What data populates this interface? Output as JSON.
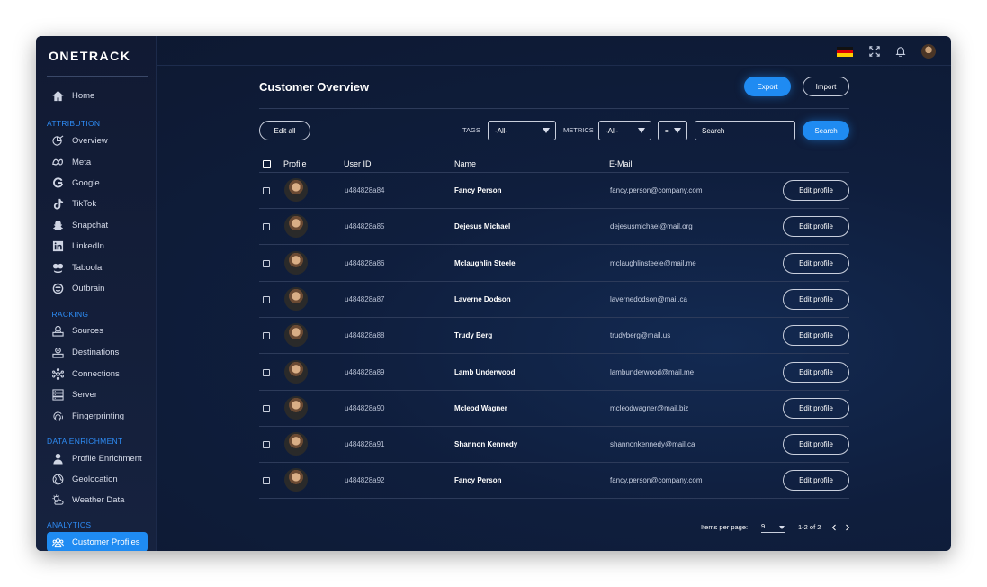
{
  "app": {
    "logo": "ONETRACK"
  },
  "sidebar": {
    "items": [
      {
        "label": "Home",
        "icon": "home-icon"
      },
      {
        "section": "ATTRIBUTION"
      },
      {
        "label": "Overview",
        "icon": "overview-icon"
      },
      {
        "label": "Meta",
        "icon": "meta-icon"
      },
      {
        "label": "Google",
        "icon": "google-icon"
      },
      {
        "label": "TikTok",
        "icon": "tiktok-icon"
      },
      {
        "label": "Snapchat",
        "icon": "snapchat-icon"
      },
      {
        "label": "LinkedIn",
        "icon": "linkedin-icon"
      },
      {
        "label": "Taboola",
        "icon": "taboola-icon"
      },
      {
        "label": "Outbrain",
        "icon": "outbrain-icon"
      },
      {
        "section": "TRACKING"
      },
      {
        "label": "Sources",
        "icon": "sources-icon"
      },
      {
        "label": "Destinations",
        "icon": "destinations-icon"
      },
      {
        "label": "Connections",
        "icon": "connections-icon"
      },
      {
        "label": "Server",
        "icon": "server-icon"
      },
      {
        "label": "Fingerprinting",
        "icon": "fingerprint-icon"
      },
      {
        "section": "DATA ENRICHMENT"
      },
      {
        "label": "Profile Enrichment",
        "icon": "user-icon"
      },
      {
        "label": "Geolocation",
        "icon": "globe-icon"
      },
      {
        "label": "Weather Data",
        "icon": "weather-icon"
      },
      {
        "section": "ANALYTICS"
      },
      {
        "label": "Customer Profiles",
        "icon": "users-icon",
        "active": true
      }
    ]
  },
  "topbar": {
    "language_flag": "germany-flag-icon"
  },
  "main": {
    "title": "Customer Overview",
    "export_label": "Export",
    "import_label": "Import",
    "edit_all_label": "Edit all",
    "filters": {
      "tags_label": "TAGS",
      "tags_value": "-All-",
      "metrics_label": "METRICS",
      "metrics_value": "-All-",
      "operator_value": "=",
      "search_placeholder": "Search",
      "search_button": "Search"
    },
    "table": {
      "columns": [
        "Profile",
        "User ID",
        "Name",
        "E-Mail"
      ],
      "edit_label": "Edit profile",
      "rows": [
        {
          "user_id": "u484828a84",
          "name": "Fancy Person",
          "email": "fancy.person@company.com"
        },
        {
          "user_id": "u484828a85",
          "name": "Dejesus Michael",
          "email": "dejesusmichael@mail.org"
        },
        {
          "user_id": "u484828a86",
          "name": "Mclaughlin Steele",
          "email": "mclaughlinsteele@mail.me"
        },
        {
          "user_id": "u484828a87",
          "name": "Laverne Dodson",
          "email": "lavernedodson@mail.ca"
        },
        {
          "user_id": "u484828a88",
          "name": "Trudy Berg",
          "email": "trudyberg@mail.us"
        },
        {
          "user_id": "u484828a89",
          "name": "Lamb Underwood",
          "email": "lambunderwood@mail.me"
        },
        {
          "user_id": "u484828a90",
          "name": "Mcleod Wagner",
          "email": "mcleodwagner@mail.biz"
        },
        {
          "user_id": "u484828a91",
          "name": "Shannon Kennedy",
          "email": "shannonkennedy@mail.ca"
        },
        {
          "user_id": "u484828a92",
          "name": "Fancy Person",
          "email": "fancy.person@company.com"
        }
      ]
    },
    "pagination": {
      "items_per_page_label": "Items per page:",
      "items_per_page_value": "9",
      "range": "1-2 of 2"
    }
  },
  "colors": {
    "accent": "#1f8bf2",
    "background": "#0f1e3d",
    "section": "#2e8cf5"
  }
}
